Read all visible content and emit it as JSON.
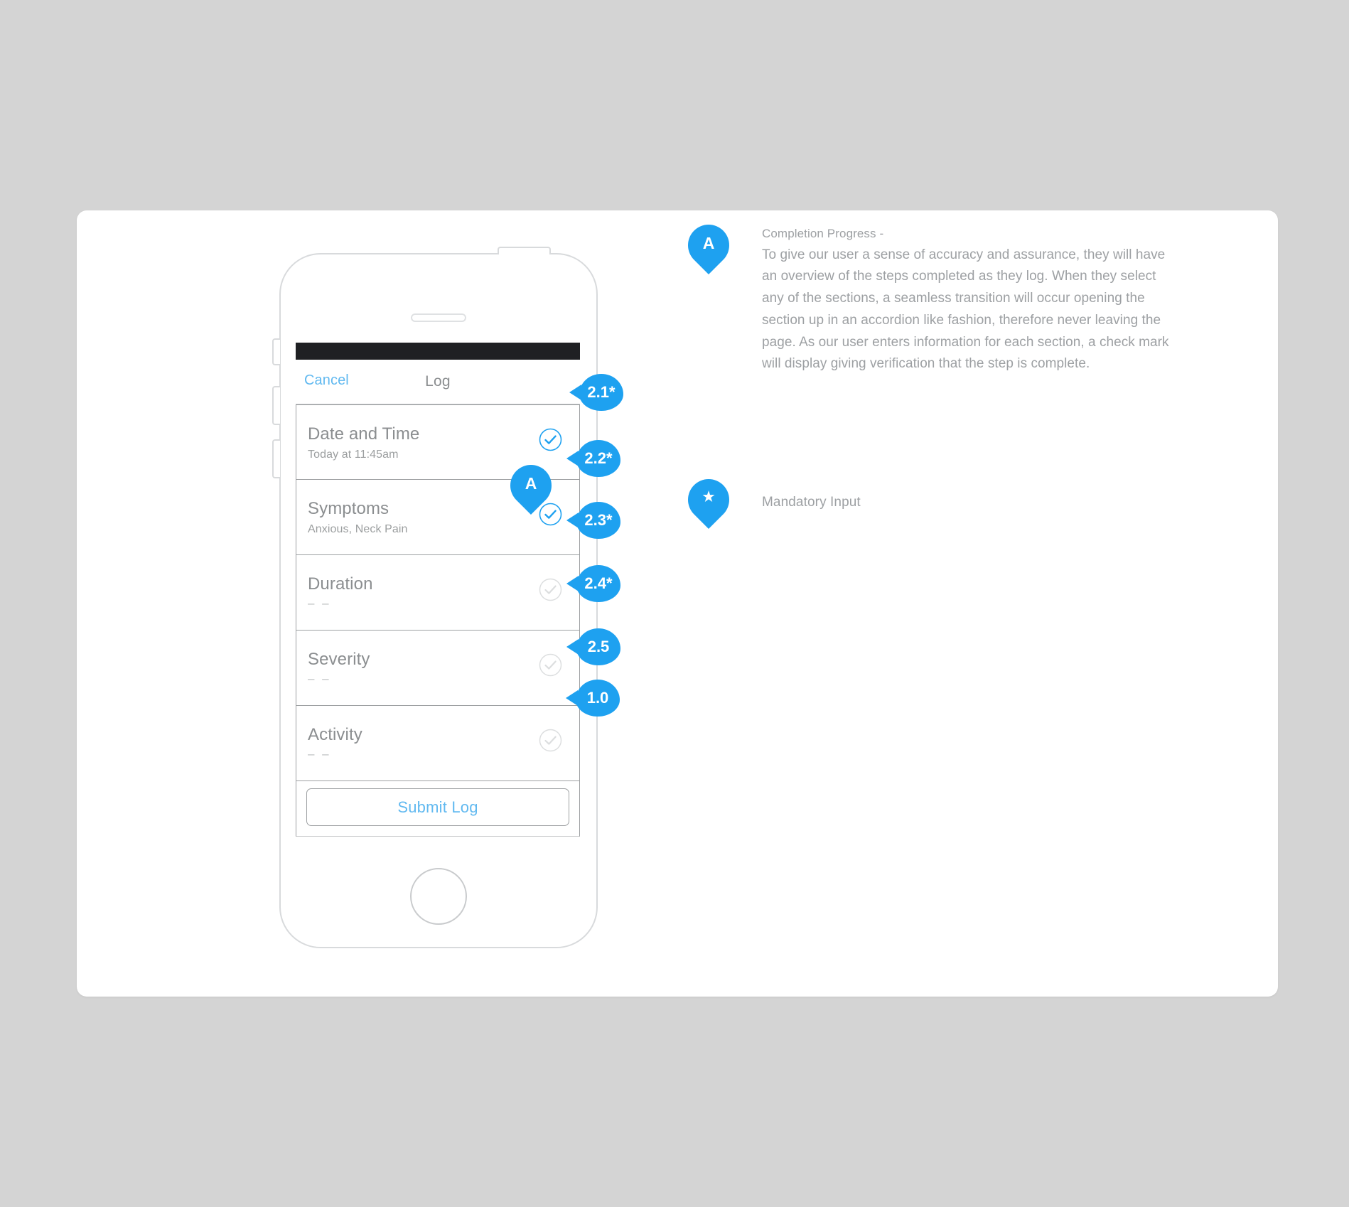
{
  "canvas": {
    "background_color": "#d4d4d4",
    "card_color": "#ffffff",
    "accent_color": "#1ea1f0",
    "muted_text_color": "#9da0a3"
  },
  "phone": {
    "status_bar_color": "#1f2023",
    "nav": {
      "cancel_label": "Cancel",
      "title": "Log"
    },
    "rows": [
      {
        "label": "Date and Time",
        "value": "Today at 11:45am",
        "completed": true,
        "callout": "2.1*"
      },
      {
        "label": "Symptoms",
        "value": "Anxious, Neck Pain",
        "completed": true,
        "callout": "2.2*"
      },
      {
        "label": "Duration",
        "value": "– –",
        "completed": false,
        "callout": "2.3*"
      },
      {
        "label": "Severity",
        "value": "– –",
        "completed": false,
        "callout": "2.4*"
      },
      {
        "label": "Activity",
        "value": "– –",
        "completed": false,
        "callout": "2.5"
      }
    ],
    "submit": {
      "label": "Submit Log",
      "callout": "1.0"
    },
    "inline_pin": "A"
  },
  "notes": [
    {
      "pin": "A",
      "title": "Completion Progress -",
      "text": "To give our user a sense of accuracy and assurance, they will have an overview of the steps completed as they log. When they select any of the sections, a seamless transition will occur opening the section up in an accordion like fashion, therefore never leaving the page. As our user enters information for each section, a check mark will display giving verification that the step is complete."
    },
    {
      "pin": "★",
      "label": "Mandatory Input"
    }
  ]
}
